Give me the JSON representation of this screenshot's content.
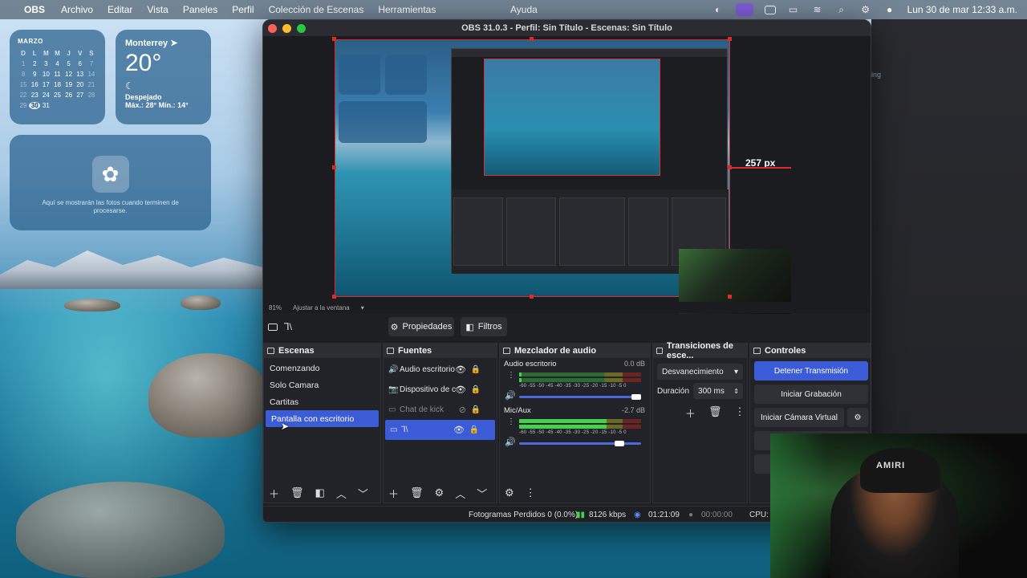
{
  "menubar": {
    "app": "OBS",
    "items": [
      "Archivo",
      "Editar",
      "Vista",
      "Paneles",
      "Perfil",
      "Colección de Escenas",
      "Herramientas"
    ],
    "help": "Ayuda",
    "clock": "Lun 30 de mar  12:33 a.m."
  },
  "calendar": {
    "month": "MARZO",
    "weekdays": [
      "D",
      "L",
      "M",
      "M",
      "J",
      "V",
      "S"
    ],
    "weeks": [
      [
        "1",
        "2",
        "3",
        "4",
        "5",
        "6",
        "7"
      ],
      [
        "8",
        "9",
        "10",
        "11",
        "12",
        "13",
        "14"
      ],
      [
        "15",
        "16",
        "17",
        "18",
        "19",
        "20",
        "21"
      ],
      [
        "22",
        "23",
        "24",
        "25",
        "26",
        "27",
        "28"
      ],
      [
        "29",
        "30",
        "31",
        "",
        "",
        "",
        ""
      ]
    ],
    "today": "30"
  },
  "weather": {
    "city": "Monterrey",
    "temp": "20°",
    "condition": "Despejado",
    "highlow": "Máx.: 28° Mín.: 14°"
  },
  "photos": {
    "message": "Aquí se mostrarán las fotos cuando terminen de procesarse."
  },
  "obs": {
    "title": "OBS 31.0.3 - Perfil: Sin Título - Escenas: Sin Título",
    "px_badge": "257 px",
    "zoom": "81%",
    "zoom_mode": "Ajustar a la ventana",
    "selected_source_short": "Ꞁ\\",
    "toolbar": {
      "properties": "Propiedades",
      "filters": "Filtros"
    },
    "scenes": {
      "title": "Escenas",
      "items": [
        "Comenzando",
        "Solo Camara",
        "Cartitas",
        "Pantalla con escritorio"
      ]
    },
    "sources": {
      "title": "Fuentes",
      "items": [
        "Audio escritorio",
        "Dispositivo de c",
        "Chat de kick",
        "Ꞁ\\"
      ]
    },
    "mixer": {
      "title": "Mezclador de audio",
      "channels": [
        {
          "name": "Audio escritorio",
          "db": "0.0 dB",
          "level": 0.02,
          "volume": 1.0
        },
        {
          "name": "Mic/Aux",
          "db": "-2.7 dB",
          "level": 0.72,
          "volume": 0.86
        }
      ],
      "scale": "-60 -55 -50 -45 -40 -35 -30 -25 -20 -15 -10 -5 0"
    },
    "transitions": {
      "title": "Transiciones de esce...",
      "selected": "Desvanecimiento",
      "duration_label": "Duración",
      "duration_value": "300 ms"
    },
    "controls": {
      "title": "Controles",
      "stop_stream": "Detener Transmisión",
      "start_recording": "Iniciar Grabación",
      "virtual_cam": "Iniciar Cámara Virtual"
    },
    "status": {
      "dropped": "Fotogramas Perdidos 0 (0.0%)",
      "bitrate": "8126 kbps",
      "stream_time": "01:21:09",
      "rec_time": "00:00:00",
      "cpu": "CPU: 8"
    }
  },
  "right_edge_text": "ing",
  "webcam": {
    "cap_text": "AMIRI"
  },
  "colors": {
    "accent": "#3c5bd6",
    "red_outline": "#e02a2a"
  }
}
